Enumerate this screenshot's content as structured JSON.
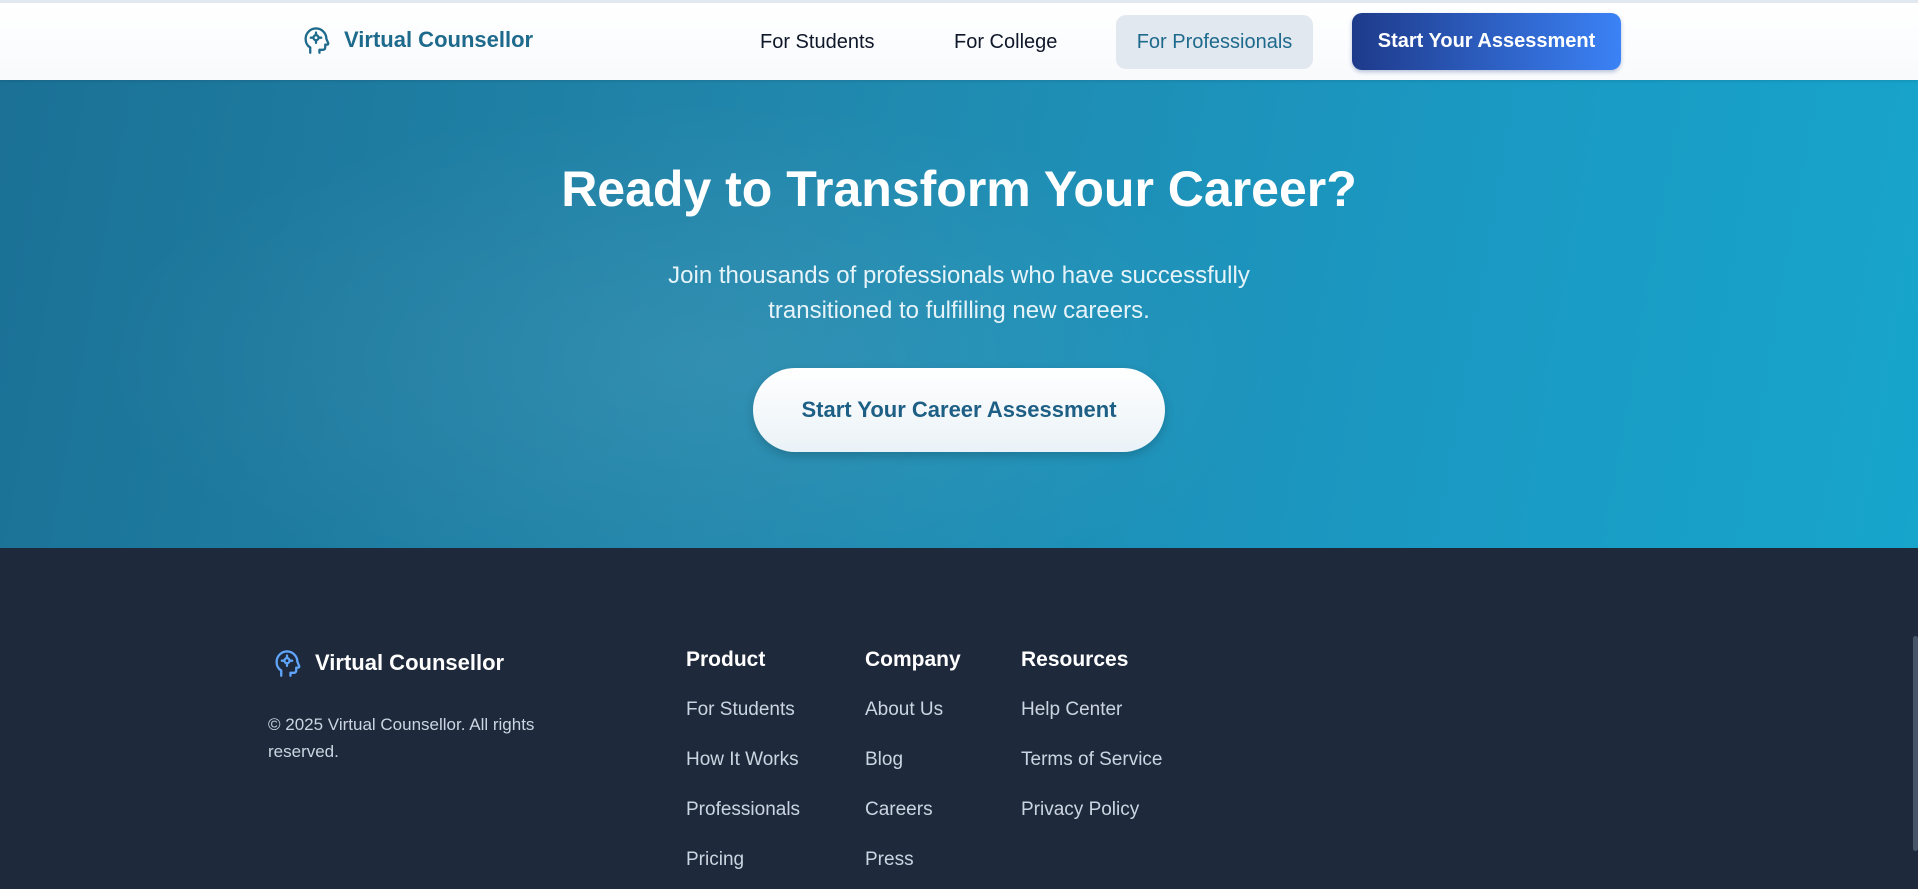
{
  "header": {
    "brand": "Virtual Counsellor",
    "nav": {
      "students": "For Students",
      "college": "For College",
      "professionals": "For Professionals"
    },
    "cta": "Start Your Assessment"
  },
  "hero": {
    "title": "Ready to Transform Your Career?",
    "subtitle_line1": "Join thousands of professionals who have successfully",
    "subtitle_line2": "transitioned to fulfilling new careers.",
    "button": "Start Your Career Assessment"
  },
  "footer": {
    "brand": "Virtual Counsellor",
    "copyright_line1": "© 2025 Virtual Counsellor. All rights",
    "copyright_line2": "reserved.",
    "columns": [
      {
        "title": "Product",
        "links": [
          "For Students",
          "How It Works",
          "Professionals",
          "Pricing"
        ]
      },
      {
        "title": "Company",
        "links": [
          "About Us",
          "Blog",
          "Careers",
          "Press"
        ]
      },
      {
        "title": "Resources",
        "links": [
          "Help Center",
          "Terms of Service",
          "Privacy Policy"
        ]
      }
    ]
  },
  "colors": {
    "brand_primary": "#1e6a8c",
    "cta_gradient_start": "#1e3a8a",
    "cta_gradient_end": "#3b82f6",
    "footer_bg": "#1e293b",
    "footer_logo": "#60a5fa"
  },
  "icons": {
    "logo": "head-brain-icon"
  }
}
